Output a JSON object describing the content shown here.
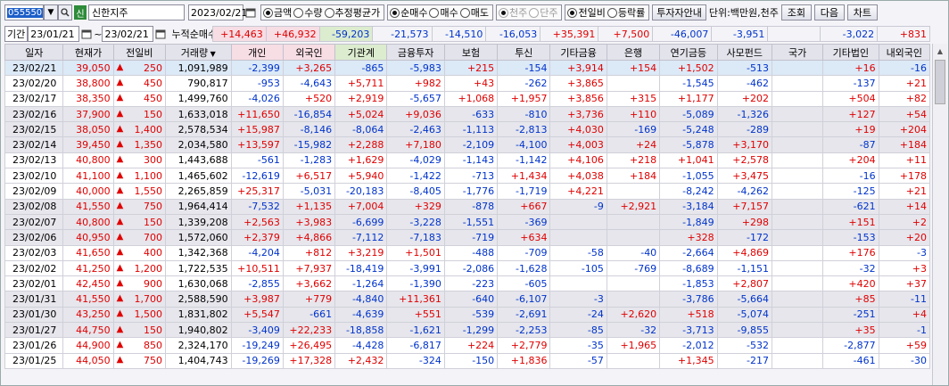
{
  "toolbar": {
    "code": "055550",
    "badge": "신",
    "name": "신한지주",
    "date": "2023/02/21",
    "radio_group1": [
      {
        "label": "금액",
        "on": true
      },
      {
        "label": "수량",
        "on": false
      },
      {
        "label": "추정평균가",
        "on": false
      }
    ],
    "radio_group2": [
      {
        "label": "순매수",
        "on": true
      },
      {
        "label": "매수",
        "on": false
      },
      {
        "label": "매도",
        "on": false
      }
    ],
    "radio_group3": [
      {
        "label": "천주",
        "on": true
      },
      {
        "label": "단주",
        "on": false
      }
    ],
    "radio_group4": [
      {
        "label": "전일비",
        "on": true
      },
      {
        "label": "등락률",
        "on": false
      }
    ],
    "invest_guide": "투자자안내",
    "unit": "단위:백만원,천주",
    "query": "조회",
    "next": "다음",
    "chart": "차트"
  },
  "period": {
    "label": "기간",
    "from": "23/01/21",
    "to": "23/02/21",
    "cum_label": "누적순매수"
  },
  "summary": [
    "+14,463",
    "+46,932",
    "-59,203",
    "-21,573",
    "-14,510",
    "-16,053",
    "+35,391",
    "+7,500",
    "-46,007",
    "-3,951",
    "",
    "-3,022",
    "+831"
  ],
  "columns": [
    "일자",
    "현재가",
    "전일비",
    "거래량",
    "개인",
    "외국인",
    "기관계",
    "금융투자",
    "보험",
    "투신",
    "기타금융",
    "은행",
    "연기금등",
    "사모펀드",
    "국가",
    "기타법인",
    "내외국인"
  ],
  "rows": [
    [
      "23/02/21",
      "39,050",
      "250",
      "1,091,989",
      "-2,399",
      "+3,265",
      "-865",
      "-5,983",
      "+215",
      "-154",
      "+3,914",
      "+154",
      "+1,502",
      "-513",
      "",
      "+16",
      "-16"
    ],
    [
      "23/02/20",
      "38,800",
      "450",
      "790,817",
      "-953",
      "-4,643",
      "+5,711",
      "+982",
      "+43",
      "-262",
      "+3,865",
      "",
      "-1,545",
      "-462",
      "",
      "-137",
      "+21"
    ],
    [
      "23/02/17",
      "38,350",
      "450",
      "1,499,760",
      "-4,026",
      "+520",
      "+2,919",
      "-5,657",
      "+1,068",
      "+1,957",
      "+3,856",
      "+315",
      "+1,177",
      "+202",
      "",
      "+504",
      "+82"
    ],
    [
      "23/02/16",
      "37,900",
      "150",
      "1,633,018",
      "+11,650",
      "-16,854",
      "+5,024",
      "+9,036",
      "-633",
      "-810",
      "+3,736",
      "+110",
      "-5,089",
      "-1,326",
      "",
      "+127",
      "+54"
    ],
    [
      "23/02/15",
      "38,050",
      "1,400",
      "2,578,534",
      "+15,987",
      "-8,146",
      "-8,064",
      "-2,463",
      "-1,113",
      "-2,813",
      "+4,030",
      "-169",
      "-5,248",
      "-289",
      "",
      "+19",
      "+204"
    ],
    [
      "23/02/14",
      "39,450",
      "1,350",
      "2,034,580",
      "+13,597",
      "-15,982",
      "+2,288",
      "+7,180",
      "-2,109",
      "-4,100",
      "+4,003",
      "+24",
      "-5,878",
      "+3,170",
      "",
      "-87",
      "+184"
    ],
    [
      "23/02/13",
      "40,800",
      "300",
      "1,443,688",
      "-561",
      "-1,283",
      "+1,629",
      "-4,029",
      "-1,143",
      "-1,142",
      "+4,106",
      "+218",
      "+1,041",
      "+2,578",
      "",
      "+204",
      "+11"
    ],
    [
      "23/02/10",
      "41,100",
      "1,100",
      "1,465,602",
      "-12,619",
      "+6,517",
      "+5,940",
      "-1,422",
      "-713",
      "+1,434",
      "+4,038",
      "+184",
      "-1,055",
      "+3,475",
      "",
      "-16",
      "+178"
    ],
    [
      "23/02/09",
      "40,000",
      "1,550",
      "2,265,859",
      "+25,317",
      "-5,031",
      "-20,183",
      "-8,405",
      "-1,776",
      "-1,719",
      "+4,221",
      "",
      "-8,242",
      "-4,262",
      "",
      "-125",
      "+21"
    ],
    [
      "23/02/08",
      "41,550",
      "750",
      "1,964,414",
      "-7,532",
      "+1,135",
      "+7,004",
      "+329",
      "-878",
      "+667",
      "-9",
      "+2,921",
      "-3,184",
      "+7,157",
      "",
      "-621",
      "+14"
    ],
    [
      "23/02/07",
      "40,800",
      "150",
      "1,339,208",
      "+2,563",
      "+3,983",
      "-6,699",
      "-3,228",
      "-1,551",
      "-369",
      "",
      "",
      "-1,849",
      "+298",
      "",
      "+151",
      "+2"
    ],
    [
      "23/02/06",
      "40,950",
      "700",
      "1,572,060",
      "+2,379",
      "+4,866",
      "-7,112",
      "-7,183",
      "-719",
      "+634",
      "",
      "",
      "+328",
      "-172",
      "",
      "-153",
      "+20"
    ],
    [
      "23/02/03",
      "41,650",
      "400",
      "1,342,368",
      "-4,204",
      "+812",
      "+3,219",
      "+1,501",
      "-488",
      "-709",
      "-58",
      "-40",
      "-2,664",
      "+4,869",
      "",
      "+176",
      "-3"
    ],
    [
      "23/02/02",
      "41,250",
      "1,200",
      "1,722,535",
      "+10,511",
      "+7,937",
      "-18,419",
      "-3,991",
      "-2,086",
      "-1,628",
      "-105",
      "-769",
      "-8,689",
      "-1,151",
      "",
      "-32",
      "+3"
    ],
    [
      "23/02/01",
      "42,450",
      "900",
      "1,630,068",
      "-2,855",
      "+3,662",
      "-1,264",
      "-1,390",
      "-223",
      "-605",
      "",
      "",
      "-1,853",
      "+2,807",
      "",
      "+420",
      "+37"
    ],
    [
      "23/01/31",
      "41,550",
      "1,700",
      "2,588,590",
      "+3,987",
      "+779",
      "-4,840",
      "+11,361",
      "-640",
      "-6,107",
      "-3",
      "",
      "-3,786",
      "-5,664",
      "",
      "+85",
      "-11"
    ],
    [
      "23/01/30",
      "43,250",
      "1,500",
      "1,831,802",
      "+5,547",
      "-661",
      "-4,639",
      "+551",
      "-539",
      "-2,691",
      "-24",
      "+2,620",
      "+518",
      "-5,074",
      "",
      "-251",
      "+4"
    ],
    [
      "23/01/27",
      "44,750",
      "150",
      "1,940,802",
      "-3,409",
      "+22,233",
      "-18,858",
      "-1,621",
      "-1,299",
      "-2,253",
      "-85",
      "-32",
      "-3,713",
      "-9,855",
      "",
      "+35",
      "-1"
    ],
    [
      "23/01/26",
      "44,900",
      "850",
      "2,324,170",
      "-19,249",
      "+26,495",
      "-4,428",
      "-6,817",
      "+224",
      "+2,779",
      "-35",
      "+1,965",
      "-2,012",
      "-532",
      "",
      "-2,877",
      "+59"
    ],
    [
      "23/01/25",
      "44,050",
      "750",
      "1,404,743",
      "-19,269",
      "+17,328",
      "+2,432",
      "-324",
      "-150",
      "+1,836",
      "-57",
      "",
      "+1,345",
      "-217",
      "",
      "-461",
      "-30"
    ]
  ],
  "colors": {
    "plus": "#e00000",
    "minus": "#0033cc",
    "pink": "#f7dde4",
    "green": "#dceccf"
  }
}
